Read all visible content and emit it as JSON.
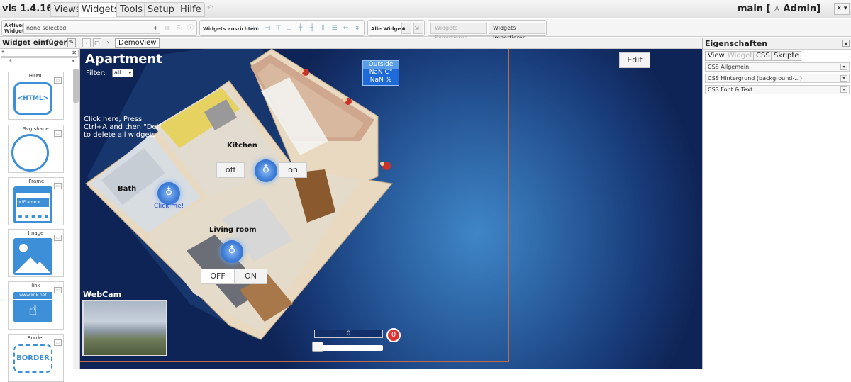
{
  "app": {
    "title": "vis 1.4.16",
    "user": "main [",
    "user_name": "Admin]",
    "user_icon": "person-icon",
    "window_btn": "✕ ▾"
  },
  "menu": {
    "tabs": [
      "Views",
      "Widgets",
      "Tools",
      "Setup",
      "Hilfe"
    ],
    "active": "Widgets"
  },
  "toolbar": {
    "active_widget_label_1": "Aktives",
    "active_widget_label_2": "Widget:",
    "active_widget_value": "none selected",
    "align_label": "Widgets ausrichten:",
    "all_widgets_label": "Alle Widgets:",
    "export_label": "Widgets Exportieren",
    "import_label": "Widgets Importieren"
  },
  "palette": {
    "title": "Widget einfügen",
    "filter_value": "*",
    "category_value": "*",
    "items": [
      {
        "name": "HTML",
        "preview": "<HTML>"
      },
      {
        "name": "Svg shape",
        "preview": ""
      },
      {
        "name": "iFrame",
        "preview": "<iFrame>"
      },
      {
        "name": "Image",
        "preview": ""
      },
      {
        "name": "link",
        "preview": "www.link.net"
      },
      {
        "name": "Border",
        "preview": "BORDER"
      }
    ]
  },
  "views": {
    "current": "DemoView"
  },
  "canvas": {
    "title": "Apartment",
    "filter_label": "Filter:",
    "filter_value": "all",
    "hint": "Click here, Press Ctrl+A and then \"Del\" to delete all widgets",
    "outside": {
      "header": "Outside",
      "temp": "NaN C°",
      "humidity": "NaN %"
    },
    "edit_label": "Edit",
    "rooms": {
      "kitchen": "Kitchen",
      "bath": "Bath",
      "living": "Living room"
    },
    "kitchen_off": "off",
    "kitchen_on": "on",
    "bath_click": "Click me!",
    "living_off": "OFF",
    "living_on": "ON",
    "webcam_label": "WebCam",
    "slider_value": "0",
    "counter": "0"
  },
  "properties": {
    "title": "Eigenschaften",
    "tabs": [
      "View",
      "Widget",
      "CSS",
      "Skripte"
    ],
    "active_tab": "View",
    "disabled_tab": "Widget",
    "sections": [
      "CSS Allgemein",
      "CSS Hintergrund (background-...)",
      "CSS Font & Text"
    ]
  }
}
